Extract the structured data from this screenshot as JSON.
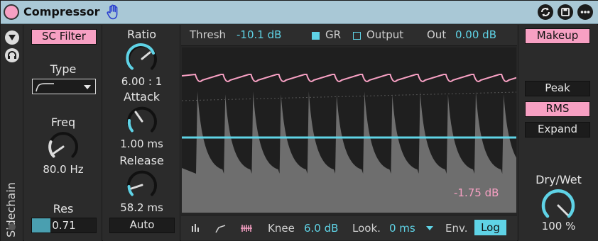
{
  "device": {
    "title": "Compressor",
    "colors": {
      "title_bar": "#a9c8d6",
      "accent_pink": "#f7a0c3",
      "accent_blue": "#5fd3e6"
    }
  },
  "sidebar": {
    "label": "Sidechain",
    "icons": [
      "collapse-triangle-icon",
      "headphone-icon"
    ]
  },
  "sidechain": {
    "filter_button": "SC Filter",
    "type_label": "Type",
    "freq_label": "Freq",
    "freq_value": "80.0 Hz",
    "res_label": "Res",
    "res_value": "0.71",
    "res_fill_fraction": 0.29
  },
  "params": {
    "ratio_label": "Ratio",
    "ratio_value": "6.00 : 1",
    "attack_label": "Attack",
    "attack_value": "1.00 ms",
    "release_label": "Release",
    "release_value": "58.2 ms",
    "auto_button": "Auto"
  },
  "display": {
    "thresh_label": "Thresh",
    "thresh_value": "-10.1 dB",
    "gr_label": "GR",
    "output_label": "Output",
    "out_label": "Out",
    "out_value": "0.00 dB",
    "gr_readout": "-1.75 dB",
    "knee_label": "Knee",
    "knee_value": "6.0 dB",
    "look_label": "Look.",
    "look_value": "0 ms",
    "env_label": "Env.",
    "log_button": "Log"
  },
  "right": {
    "makeup_button": "Makeup",
    "peak_button": "Peak",
    "rms_button": "RMS",
    "expand_button": "Expand",
    "drywet_label": "Dry/Wet",
    "drywet_value": "100 %"
  }
}
